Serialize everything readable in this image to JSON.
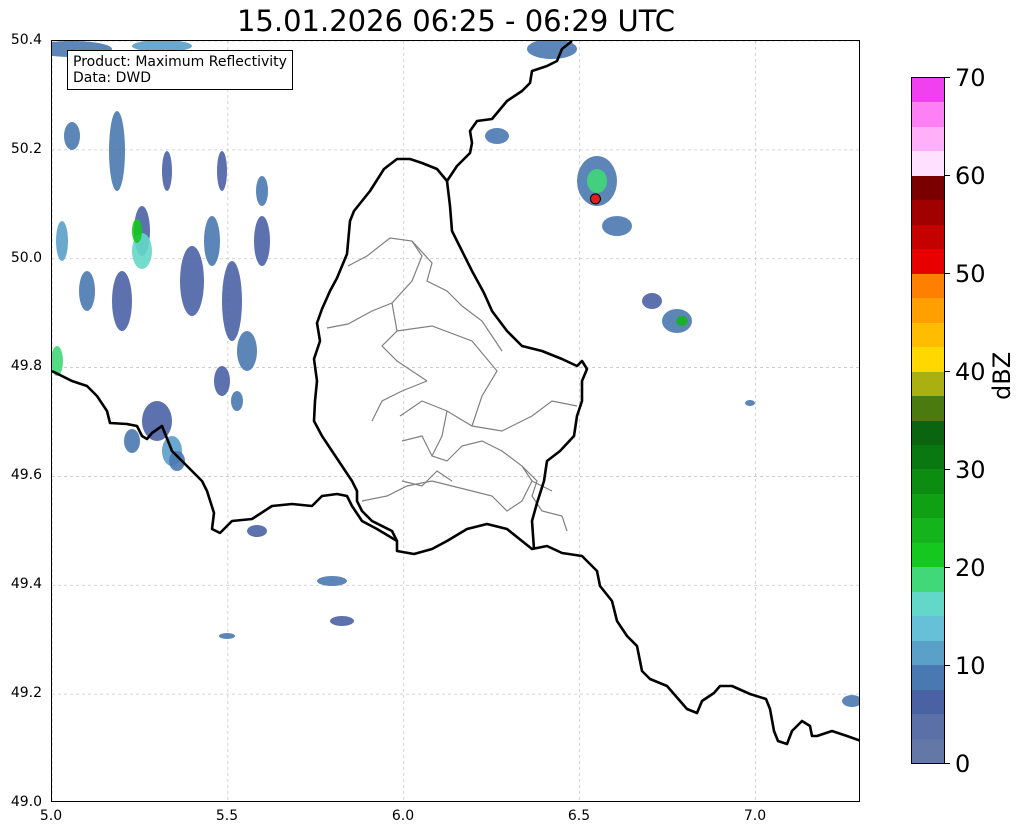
{
  "title": "15.01.2026 06:25 - 06:29 UTC",
  "info": {
    "product": "Product: Maximum Reflectivity",
    "data": "Data: DWD"
  },
  "axes": {
    "x_ticks": [
      "5.0",
      "5.5",
      "6.0",
      "6.5",
      "7.0"
    ],
    "y_ticks": [
      "50.4",
      "50.2",
      "50.0",
      "49.8",
      "49.6",
      "49.4",
      "49.2",
      "49.0"
    ],
    "xlim": [
      5.0,
      7.3
    ],
    "ylim": [
      49.0,
      50.4
    ],
    "grid": true
  },
  "colorbar": {
    "label": "dBZ",
    "ticks": [
      "0",
      "10",
      "20",
      "30",
      "40",
      "50",
      "60",
      "70"
    ],
    "range": [
      0,
      70
    ],
    "colors": [
      "#6478a8",
      "#5c70a8",
      "#4a62a4",
      "#4a78b0",
      "#5aa0c8",
      "#66c0d8",
      "#64d8c8",
      "#40d878",
      "#14c820",
      "#14b41c",
      "#10a014",
      "#0c8c10",
      "#0a7810",
      "#0a6410",
      "#4a7a10",
      "#aab010",
      "#ffd800",
      "#ffbc00",
      "#ffa000",
      "#ff8000",
      "#e80000",
      "#c40000",
      "#a00000",
      "#7a0000",
      "#ffe0ff",
      "#ffb0f8",
      "#ff80f4",
      "#f040f0"
    ]
  },
  "marker": {
    "lon": 6.545,
    "lat": 50.11,
    "color": "#e02020"
  }
}
